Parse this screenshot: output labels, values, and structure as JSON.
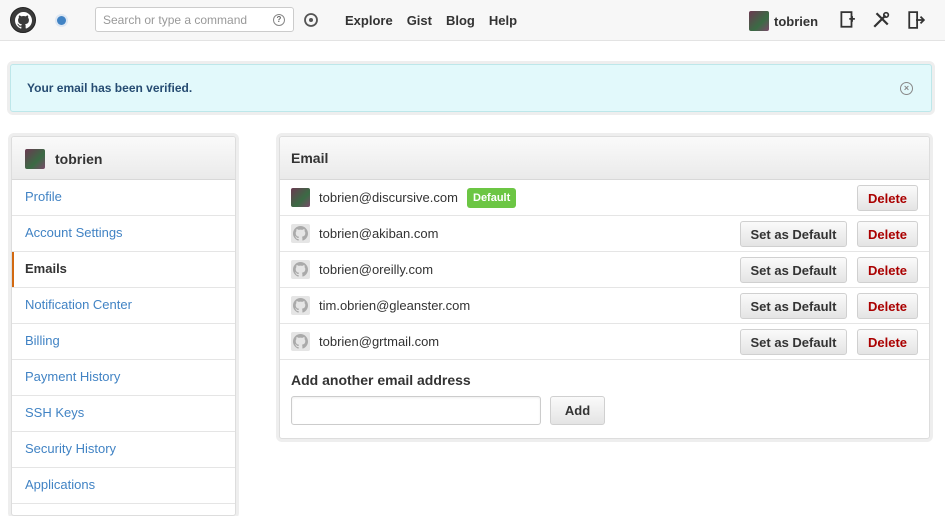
{
  "header": {
    "search_placeholder": "Search or type a command",
    "help_icon": "?",
    "nav": [
      "Explore",
      "Gist",
      "Blog",
      "Help"
    ],
    "username": "tobrien"
  },
  "flash": {
    "message": "Your email has been verified.",
    "close_icon": "×"
  },
  "sidebar": {
    "username": "tobrien",
    "items": [
      {
        "label": "Profile",
        "selected": false
      },
      {
        "label": "Account Settings",
        "selected": false
      },
      {
        "label": "Emails",
        "selected": true
      },
      {
        "label": "Notification Center",
        "selected": false
      },
      {
        "label": "Billing",
        "selected": false
      },
      {
        "label": "Payment History",
        "selected": false
      },
      {
        "label": "SSH Keys",
        "selected": false
      },
      {
        "label": "Security History",
        "selected": false
      },
      {
        "label": "Applications",
        "selected": false
      }
    ]
  },
  "email": {
    "title": "Email",
    "rows": [
      {
        "address": "tobrien@discursive.com",
        "badge": "Default",
        "set_default": "",
        "delete": "Delete"
      },
      {
        "address": "tobrien@akiban.com",
        "badge": "",
        "set_default": "Set as Default",
        "delete": "Delete"
      },
      {
        "address": "tobrien@oreilly.com",
        "badge": "",
        "set_default": "Set as Default",
        "delete": "Delete"
      },
      {
        "address": "tim.obrien@gleanster.com",
        "badge": "",
        "set_default": "Set as Default",
        "delete": "Delete"
      },
      {
        "address": "tobrien@grtmail.com",
        "badge": "",
        "set_default": "Set as Default",
        "delete": "Delete"
      }
    ],
    "add_label": "Add another email address",
    "add_value": "",
    "add_button": "Add"
  },
  "colors": {
    "link": "#4183c4",
    "flash_bg": "#e2f9fb",
    "badge_green": "#6cc644",
    "delete_red": "#aa0000"
  }
}
